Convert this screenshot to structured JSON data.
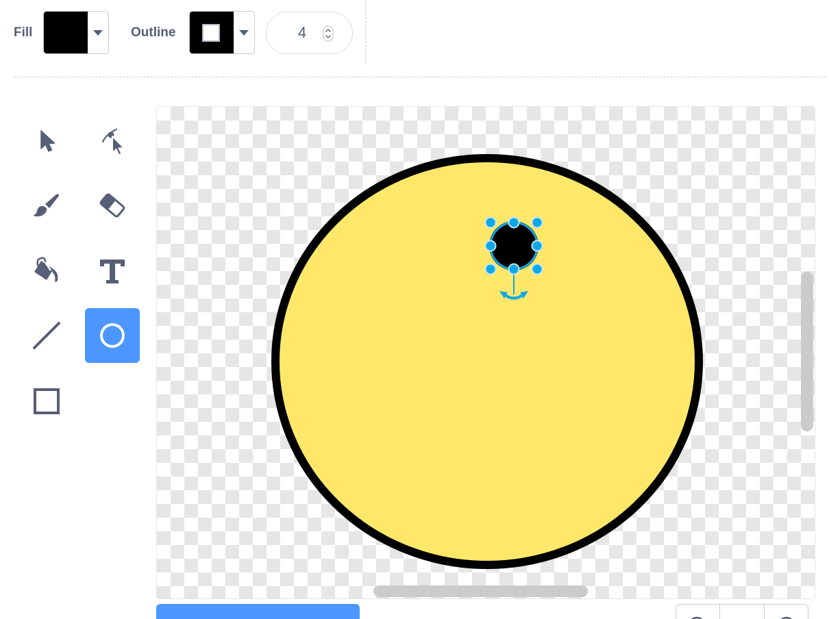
{
  "toolbar": {
    "fill_label": "Fill",
    "outline_label": "Outline",
    "stroke_width": "4",
    "fill_color": "#000000",
    "outline_color": "#000000"
  },
  "tools": [
    {
      "name": "select-tool",
      "icon": "arrow-pointer-icon"
    },
    {
      "name": "reshape-tool",
      "icon": "reshape-pointer-icon"
    },
    {
      "name": "brush-tool",
      "icon": "brush-icon"
    },
    {
      "name": "eraser-tool",
      "icon": "eraser-icon"
    },
    {
      "name": "fill-tool",
      "icon": "paint-bucket-icon"
    },
    {
      "name": "text-tool",
      "icon": "text-T-icon"
    },
    {
      "name": "line-tool",
      "icon": "line-icon"
    },
    {
      "name": "circle-tool",
      "icon": "circle-icon",
      "active": true
    },
    {
      "name": "rectangle-tool",
      "icon": "rectangle-icon"
    }
  ],
  "canvas": {
    "big_circle_fill": "#ffe76a",
    "big_circle_stroke": "#000000",
    "small_circle_fill": "#000000",
    "selection_color": "#0fa8e6"
  },
  "colors": {
    "accent": "#4c97ff",
    "icon_gray": "#575e75"
  }
}
